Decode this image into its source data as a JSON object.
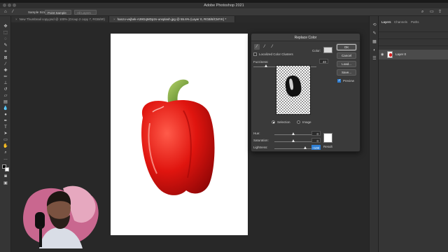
{
  "app": {
    "title": "Adobe Photoshop 2021"
  },
  "options_bar": {
    "sample_size_label": "Sample Size:",
    "sample_size_value": "Point Sample",
    "all_layers_label": "All Layers"
  },
  "tabs": [
    {
      "label": "New Thumbnail copy.psd @ 100% (Group 2 copy 7, RGB/8#)",
      "active": false
    },
    {
      "label": "hanzo-vejbek-A39GqMDp2s-unsplash.jpg @ 55.6% (Layer 0, RGB/8/CMYK) *",
      "active": true
    }
  ],
  "panels": {
    "tabs": [
      "Layers",
      "Channels",
      "Paths"
    ],
    "layer_name": "Layer 0"
  },
  "dialog": {
    "title": "Replace Color",
    "localized_clusters_label": "Localized Color Clusters",
    "color_label": "Color:",
    "selection_color": "#d9d9d9",
    "fuzziness_label": "Fuzziness:",
    "fuzziness_value": "40",
    "fuzziness_level": 0.2,
    "view_selection_label": "Selection",
    "view_image_label": "Image",
    "view_mode": "Selection",
    "hue_label": "Hue:",
    "hue_value": "0",
    "saturation_label": "Saturation:",
    "saturation_value": "0",
    "lightness_label": "Lightness:",
    "lightness_value": "+100",
    "result_label": "Result",
    "result_color": "#ffffff",
    "ok_label": "OK",
    "cancel_label": "Cancel",
    "load_label": "Load...",
    "save_label": "Save...",
    "preview_label": "Preview",
    "preview_checked": true
  }
}
